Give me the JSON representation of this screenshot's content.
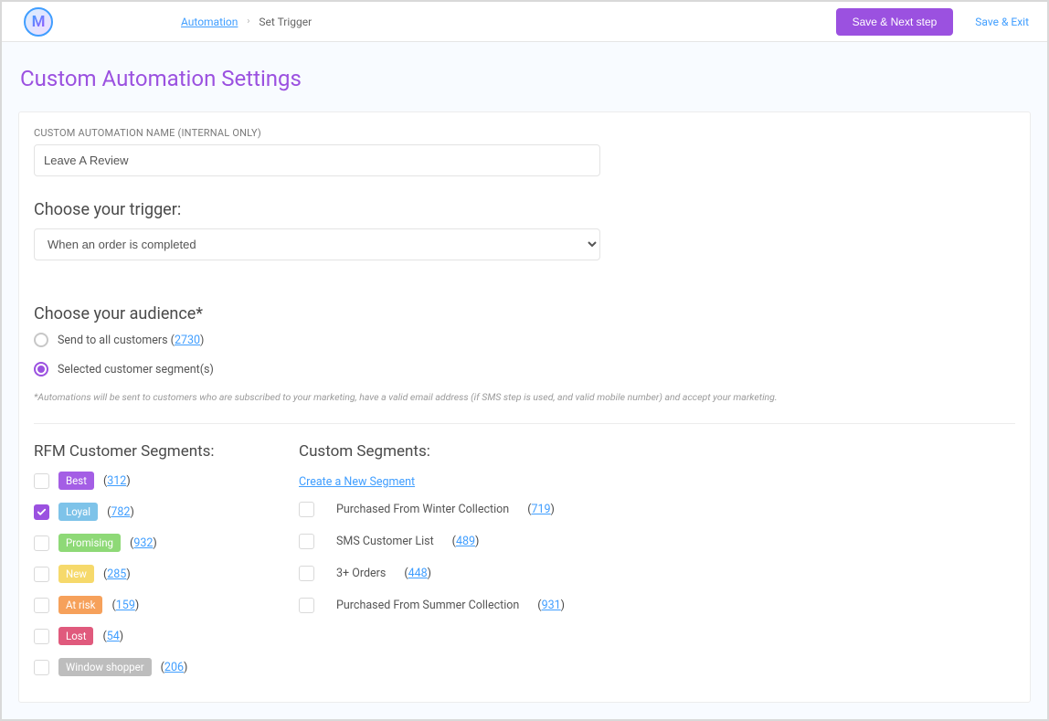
{
  "header": {
    "logo_letter": "M",
    "breadcrumb_automation": "Automation",
    "breadcrumb_current": "Set Trigger",
    "save_next": "Save & Next step",
    "save_exit": "Save & Exit"
  },
  "page_title": "Custom Automation Settings",
  "name_field": {
    "label": "CUSTOM AUTOMATION NAME (INTERNAL ONLY)",
    "value": "Leave A Review"
  },
  "trigger": {
    "title": "Choose your trigger:",
    "selected": "When an order is completed"
  },
  "audience": {
    "title": "Choose your audience*",
    "all_label": "Send to all customers",
    "all_count": "2730",
    "selected_label": "Selected customer segment(s)",
    "note": "*Automations will be sent to customers who are subscribed to your marketing, have a valid email address (if SMS step is used, and valid mobile number) and accept your marketing."
  },
  "rfm_title": "RFM Customer Segments:",
  "rfm_segments": [
    {
      "name": "Best",
      "color": "#a45ee5",
      "count": "312",
      "checked": false
    },
    {
      "name": "Loyal",
      "color": "#7ec3e9",
      "count": "782",
      "checked": true
    },
    {
      "name": "Promising",
      "color": "#8ed977",
      "count": "932",
      "checked": false
    },
    {
      "name": "New",
      "color": "#f6d96b",
      "count": "285",
      "checked": false
    },
    {
      "name": "At risk",
      "color": "#f6a15b",
      "count": "159",
      "checked": false
    },
    {
      "name": "Lost",
      "color": "#e05a7d",
      "count": "54",
      "checked": false
    },
    {
      "name": "Window shopper",
      "color": "#bdbdbd",
      "count": "206",
      "checked": false
    }
  ],
  "custom_title": "Custom Segments:",
  "create_segment": "Create a New Segment",
  "custom_segments": [
    {
      "name": "Purchased From Winter Collection",
      "count": "719"
    },
    {
      "name": "SMS Customer List",
      "count": "489"
    },
    {
      "name": "3+ Orders",
      "count": "448"
    },
    {
      "name": "Purchased From Summer Collection",
      "count": "931"
    }
  ]
}
